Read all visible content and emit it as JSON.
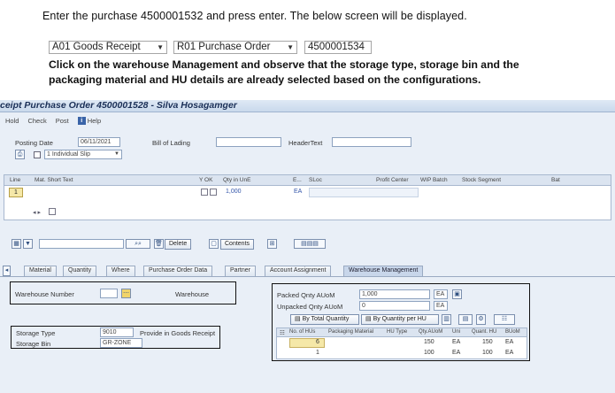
{
  "doc": {
    "instruction1": "Enter the purchase 4500001532 and press enter. The below screen will be displayed.",
    "dropdown1": "A01 Goods Receipt",
    "dropdown2": "R01 Purchase Order",
    "po_number": "4500001534",
    "instruction2_line1": "Click on the warehouse Management and observe that the storage type, storage bin and the",
    "instruction2_line2": "packaging material and HU details are already selected based on the configurations."
  },
  "sap": {
    "title": "ceipt Purchase Order 4500001528 - Silva Hosagamger",
    "menu": [
      "Hold",
      "Check",
      "Post",
      "Help"
    ],
    "posting_date_label": "Posting Date",
    "posting_date": "06/11/2021",
    "bill_of_lading_label": "Bill of Lading",
    "header_text_label": "HeaderText",
    "individual_slip": "1 Individual Slip",
    "grid_headers": [
      "Line",
      "Mat. Short Text",
      "Y OK",
      "Qty in UnE",
      "E...",
      "SLoc",
      "Profit Center",
      "WIP Batch",
      "Stock Segment",
      "Bat"
    ],
    "grid_row": {
      "line": "1",
      "qty": "1,000",
      "unit": "EA"
    },
    "delete_label": "Delete",
    "contents_label": "Contents",
    "tabs": [
      "Material",
      "Quantity",
      "Where",
      "Purchase Order Data",
      "Partner",
      "Account Assignment",
      "Warehouse Management"
    ],
    "warehouse_number_label": "Warehouse Number",
    "warehouse_label": "Warehouse",
    "storage_type_label": "Storage Type",
    "storage_type": "9010",
    "provide_label": "Provide in Goods Receipt",
    "storage_bin_label": "Storage Bin",
    "storage_bin": "GR-ZONE",
    "packed_label": "Packed Qnty AUoM",
    "packed_value": "1,000",
    "packed_unit": "EA",
    "unpacked_label": "Unpacked Qnty AUoM",
    "unpacked_value": "0",
    "unpacked_unit": "EA",
    "by_total_label": "By Total Quantity",
    "by_qty_per_hu_label": "By Quantity per HU",
    "hu_headers": [
      "No. of HUs",
      "Packaging Material",
      "HU Type",
      "Qty.AUoM",
      "Uni",
      "Quant. HU",
      "BUoM"
    ],
    "hu_rows": [
      {
        "no": "6",
        "qty": "150",
        "uni": "EA",
        "quant": "150",
        "buom": "EA"
      },
      {
        "no": "1",
        "qty": "100",
        "uni": "EA",
        "quant": "100",
        "buom": "EA"
      }
    ]
  }
}
